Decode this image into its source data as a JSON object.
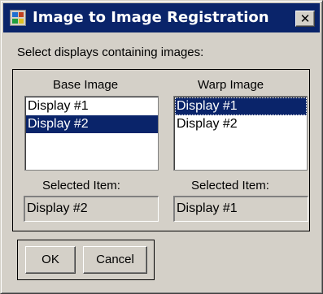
{
  "window": {
    "title": "Image to Image Registration",
    "close_glyph": "✕",
    "app_icon": "registration-app-icon"
  },
  "instruction": "Select displays containing images:",
  "base": {
    "heading": "Base Image",
    "items": [
      "Display #1",
      "Display #2"
    ],
    "selected_index": 1,
    "selected_label": "Selected Item:",
    "selected_value": "Display #2"
  },
  "warp": {
    "heading": "Warp Image",
    "items": [
      "Display #1",
      "Display #2"
    ],
    "selected_index": 0,
    "selected_label": "Selected Item:",
    "selected_value": "Display #1"
  },
  "buttons": {
    "ok": "OK",
    "cancel": "Cancel"
  },
  "colors": {
    "titlebar": "#0a246a",
    "selection": "#0a246a",
    "face": "#d4d0c8"
  }
}
